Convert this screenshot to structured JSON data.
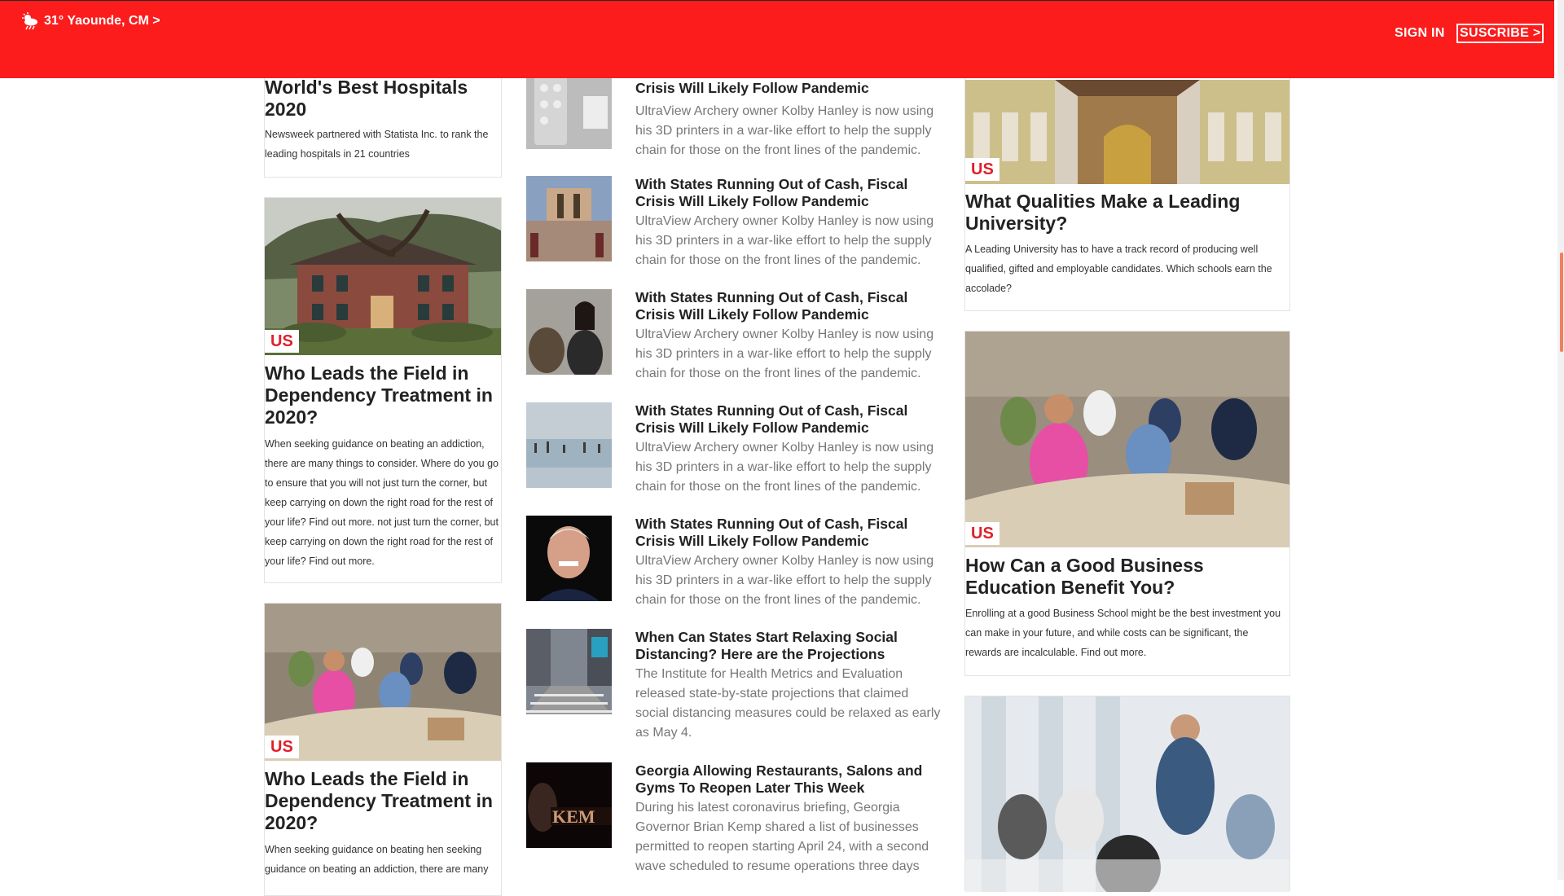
{
  "header": {
    "weather": "31° Yaounde, CM >",
    "weather_icon": "cloud-sun-rain-icon",
    "signin": "SIGN IN",
    "subscribe": "SUSCRIBE >",
    "bg_color": "#fc1c1c"
  },
  "left": {
    "card1": {
      "title": "World's Best Hospitals 2020",
      "desc": "Newsweek partnered with Statista Inc. to rank the leading hospitals in 21 countries"
    },
    "card2": {
      "tag": "US",
      "title": "Who Leads the Field in Dependency Treatment in 2020?",
      "desc": "When seeking guidance on beating an addiction, there are many things to consider. Where do you go to ensure that you will not just turn the corner, but keep carrying on down the right road for the rest of your life? Find out more. not just turn the corner, but keep carrying on down the right road for the rest of your life? Find out more."
    },
    "card3": {
      "tag": "US",
      "title": "Who Leads the Field in Dependency Treatment in 2020?",
      "desc": "When seeking guidance on beating hen seeking guidance on beating an addiction, there are many"
    }
  },
  "middle": {
    "items": [
      {
        "title": "Crisis Will Likely Follow Pandemic",
        "desc": "UltraView Archery owner Kolby Hanley is now using his 3D printers in a war-like effort to help the supply chain for those on the front lines of the pandemic."
      },
      {
        "title": "With States Running Out of Cash, Fiscal Crisis Will Likely Follow Pandemic",
        "desc": "UltraView Archery owner Kolby Hanley is now using his 3D printers in a war-like effort to help the supply chain for those on the front lines of the pandemic."
      },
      {
        "title": "With States Running Out of Cash, Fiscal Crisis Will Likely Follow Pandemic",
        "desc": "UltraView Archery owner Kolby Hanley is now using his 3D printers in a war-like effort to help the supply chain for those on the front lines of the pandemic."
      },
      {
        "title": "With States Running Out of Cash, Fiscal Crisis Will Likely Follow Pandemic",
        "desc": "UltraView Archery owner Kolby Hanley is now using his 3D printers in a war-like effort to help the supply chain for those on the front lines of the pandemic."
      },
      {
        "title": "With States Running Out of Cash, Fiscal Crisis Will Likely Follow Pandemic",
        "desc": "UltraView Archery owner Kolby Hanley is now using his 3D printers in a war-like effort to help the supply chain for those on the front lines of the pandemic."
      },
      {
        "title": "When Can States Start Relaxing Social Distancing? Here are the Projections",
        "desc": "The Institute for Health Metrics and Evaluation released state-by-state projections that claimed social distancing measures could be relaxed as early as May 4."
      },
      {
        "title": "Georgia Allowing Restaurants, Salons and Gyms To Reopen Later This Week",
        "desc": "During his latest coronavirus briefing, Georgia Governor Brian Kemp shared a list of businesses permitted to reopen starting April 24, with a second wave scheduled to resume operations three days"
      }
    ]
  },
  "right": {
    "card1": {
      "tag": "US",
      "title": "What Qualities Make a Leading University?",
      "desc": "A Leading University has to have a track record of producing well qualified, gifted and employable candidates. Which schools earn the accolade?"
    },
    "card2": {
      "tag": "US",
      "title": "How Can a Good Business Education Benefit You?",
      "desc": "Enrolling at a good Business School might be the best investment you can make in your future, and while costs can be significant, the rewards are incalculable. Find out more."
    }
  }
}
